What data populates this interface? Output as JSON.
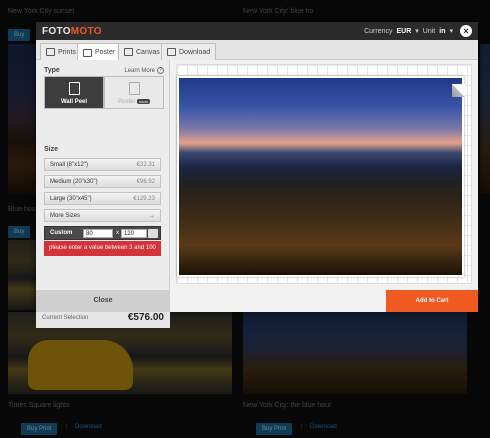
{
  "background": {
    "top_left_title": "New York City sunset",
    "top_right_title": "New York City: blue ho",
    "buy_label": "Buy",
    "buy_print_label": "Buy Print",
    "download_label": "Download",
    "mid_left_title": "Blue hou",
    "bottom_left_title": "Times Square lights",
    "bottom_right_title": "New York City: the blue hour"
  },
  "modal": {
    "logo_part1": "FOTO",
    "logo_part2": "MOTO",
    "currency_label": "Currency",
    "currency_value": "EUR",
    "unit_label": "Unit",
    "unit_value": "in",
    "close_glyph": "×",
    "tabs": [
      {
        "label": "Prints",
        "active": false
      },
      {
        "label": "Poster",
        "active": true
      },
      {
        "label": "Canvas",
        "active": false
      },
      {
        "label": "Download",
        "active": false
      }
    ],
    "type_section": "Type",
    "learn_more": "Learn More",
    "type_options": [
      {
        "label": "Wall Peel",
        "selected": true
      },
      {
        "label": "Poster",
        "selected": false,
        "badge": "soon"
      }
    ],
    "size_section": "Size",
    "sizes": [
      {
        "name": "Small (8\"x12\")",
        "price": "€32.31"
      },
      {
        "name": "Medium (20\"x30\")",
        "price": "€96.92"
      },
      {
        "name": "Large (30\"x45\")",
        "price": "€129.23"
      }
    ],
    "more_sizes": "More Sizes",
    "more_sizes_arrow": "→",
    "custom_label": "Custom",
    "custom_width": "80",
    "custom_height": "120",
    "times_symbol": "x",
    "error_message": "please enter a value between 3 and 100",
    "current_selection_label": "Current Selection",
    "current_selection_value": "€576.00",
    "close_button": "Close",
    "add_to_cart_button": "Add to Cart"
  },
  "colors": {
    "brand_orange": "#f05a22",
    "error_red": "#d6323a",
    "header_dark": "#2b2b2b",
    "link_blue": "#3c8fd0"
  }
}
